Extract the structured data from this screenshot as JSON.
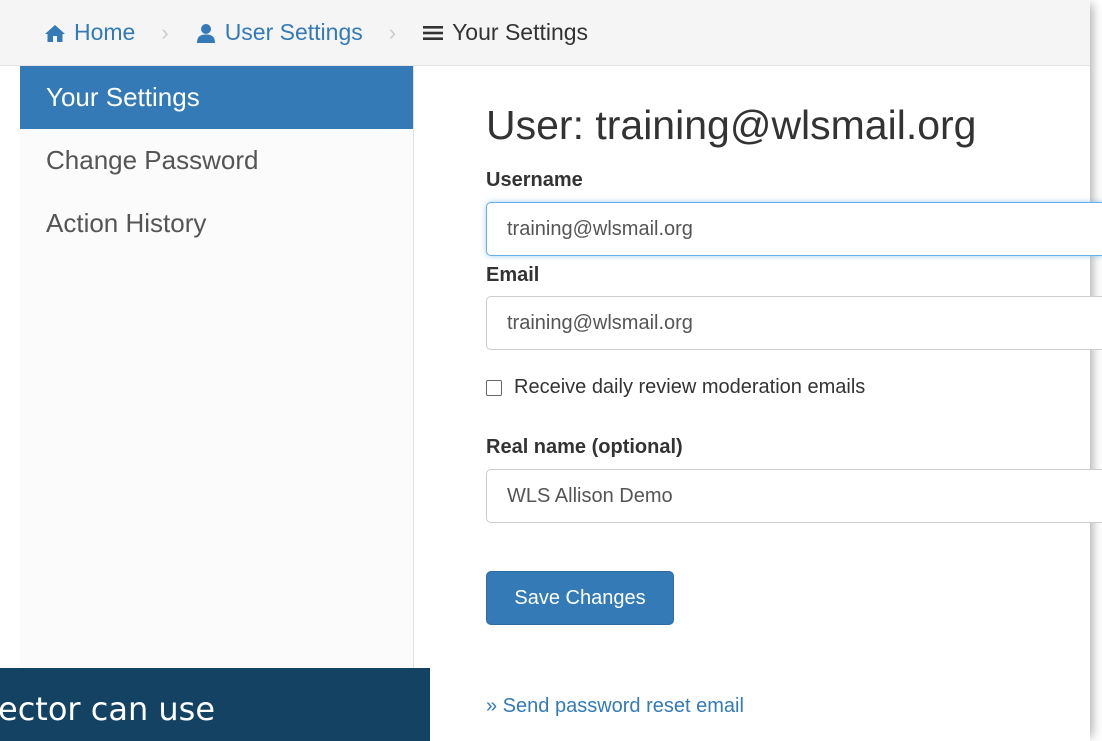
{
  "breadcrumb": {
    "home": "Home",
    "user_settings": "User Settings",
    "current": "Your Settings"
  },
  "sidebar": {
    "items": [
      {
        "label": "Your Settings",
        "active": true
      },
      {
        "label": "Change Password",
        "active": false
      },
      {
        "label": "Action History",
        "active": false
      }
    ]
  },
  "main": {
    "title": "User: training@wlsmail.org",
    "username_label": "Username",
    "username_value": "training@wlsmail.org",
    "email_label": "Email",
    "email_value": "training@wlsmail.org",
    "checkbox_label": "Receive daily review moderation emails",
    "checkbox_checked": false,
    "realname_label": "Real name (optional)",
    "realname_value": "WLS Allison Demo",
    "save_label": "Save Changes",
    "reset_link": "» Send password reset email"
  },
  "overlay": {
    "caption": "ector can use"
  },
  "colors": {
    "primary": "#337ab7",
    "caption_bg": "#134263"
  },
  "icons": {
    "home": "home-icon",
    "user": "user-icon",
    "menu": "menu-icon",
    "separator": "chevron-right-icon"
  }
}
